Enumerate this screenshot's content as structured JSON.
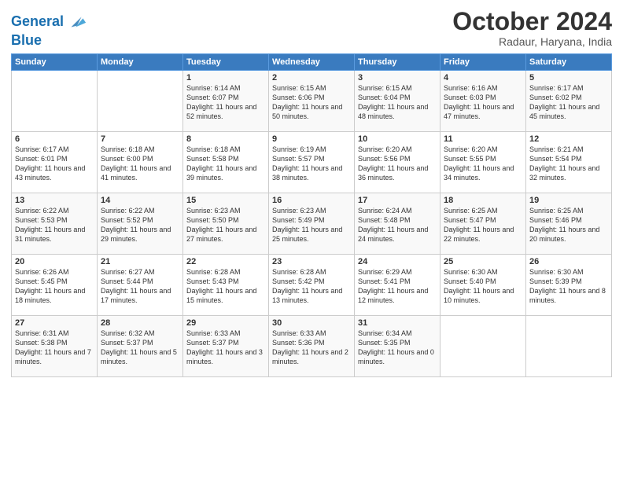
{
  "logo": {
    "line1": "General",
    "line2": "Blue"
  },
  "header": {
    "month": "October 2024",
    "location": "Radaur, Haryana, India"
  },
  "weekdays": [
    "Sunday",
    "Monday",
    "Tuesday",
    "Wednesday",
    "Thursday",
    "Friday",
    "Saturday"
  ],
  "weeks": [
    [
      {
        "day": "",
        "content": ""
      },
      {
        "day": "",
        "content": ""
      },
      {
        "day": "1",
        "content": "Sunrise: 6:14 AM\nSunset: 6:07 PM\nDaylight: 11 hours and 52 minutes."
      },
      {
        "day": "2",
        "content": "Sunrise: 6:15 AM\nSunset: 6:06 PM\nDaylight: 11 hours and 50 minutes."
      },
      {
        "day": "3",
        "content": "Sunrise: 6:15 AM\nSunset: 6:04 PM\nDaylight: 11 hours and 48 minutes."
      },
      {
        "day": "4",
        "content": "Sunrise: 6:16 AM\nSunset: 6:03 PM\nDaylight: 11 hours and 47 minutes."
      },
      {
        "day": "5",
        "content": "Sunrise: 6:17 AM\nSunset: 6:02 PM\nDaylight: 11 hours and 45 minutes."
      }
    ],
    [
      {
        "day": "6",
        "content": "Sunrise: 6:17 AM\nSunset: 6:01 PM\nDaylight: 11 hours and 43 minutes."
      },
      {
        "day": "7",
        "content": "Sunrise: 6:18 AM\nSunset: 6:00 PM\nDaylight: 11 hours and 41 minutes."
      },
      {
        "day": "8",
        "content": "Sunrise: 6:18 AM\nSunset: 5:58 PM\nDaylight: 11 hours and 39 minutes."
      },
      {
        "day": "9",
        "content": "Sunrise: 6:19 AM\nSunset: 5:57 PM\nDaylight: 11 hours and 38 minutes."
      },
      {
        "day": "10",
        "content": "Sunrise: 6:20 AM\nSunset: 5:56 PM\nDaylight: 11 hours and 36 minutes."
      },
      {
        "day": "11",
        "content": "Sunrise: 6:20 AM\nSunset: 5:55 PM\nDaylight: 11 hours and 34 minutes."
      },
      {
        "day": "12",
        "content": "Sunrise: 6:21 AM\nSunset: 5:54 PM\nDaylight: 11 hours and 32 minutes."
      }
    ],
    [
      {
        "day": "13",
        "content": "Sunrise: 6:22 AM\nSunset: 5:53 PM\nDaylight: 11 hours and 31 minutes."
      },
      {
        "day": "14",
        "content": "Sunrise: 6:22 AM\nSunset: 5:52 PM\nDaylight: 11 hours and 29 minutes."
      },
      {
        "day": "15",
        "content": "Sunrise: 6:23 AM\nSunset: 5:50 PM\nDaylight: 11 hours and 27 minutes."
      },
      {
        "day": "16",
        "content": "Sunrise: 6:23 AM\nSunset: 5:49 PM\nDaylight: 11 hours and 25 minutes."
      },
      {
        "day": "17",
        "content": "Sunrise: 6:24 AM\nSunset: 5:48 PM\nDaylight: 11 hours and 24 minutes."
      },
      {
        "day": "18",
        "content": "Sunrise: 6:25 AM\nSunset: 5:47 PM\nDaylight: 11 hours and 22 minutes."
      },
      {
        "day": "19",
        "content": "Sunrise: 6:25 AM\nSunset: 5:46 PM\nDaylight: 11 hours and 20 minutes."
      }
    ],
    [
      {
        "day": "20",
        "content": "Sunrise: 6:26 AM\nSunset: 5:45 PM\nDaylight: 11 hours and 18 minutes."
      },
      {
        "day": "21",
        "content": "Sunrise: 6:27 AM\nSunset: 5:44 PM\nDaylight: 11 hours and 17 minutes."
      },
      {
        "day": "22",
        "content": "Sunrise: 6:28 AM\nSunset: 5:43 PM\nDaylight: 11 hours and 15 minutes."
      },
      {
        "day": "23",
        "content": "Sunrise: 6:28 AM\nSunset: 5:42 PM\nDaylight: 11 hours and 13 minutes."
      },
      {
        "day": "24",
        "content": "Sunrise: 6:29 AM\nSunset: 5:41 PM\nDaylight: 11 hours and 12 minutes."
      },
      {
        "day": "25",
        "content": "Sunrise: 6:30 AM\nSunset: 5:40 PM\nDaylight: 11 hours and 10 minutes."
      },
      {
        "day": "26",
        "content": "Sunrise: 6:30 AM\nSunset: 5:39 PM\nDaylight: 11 hours and 8 minutes."
      }
    ],
    [
      {
        "day": "27",
        "content": "Sunrise: 6:31 AM\nSunset: 5:38 PM\nDaylight: 11 hours and 7 minutes."
      },
      {
        "day": "28",
        "content": "Sunrise: 6:32 AM\nSunset: 5:37 PM\nDaylight: 11 hours and 5 minutes."
      },
      {
        "day": "29",
        "content": "Sunrise: 6:33 AM\nSunset: 5:37 PM\nDaylight: 11 hours and 3 minutes."
      },
      {
        "day": "30",
        "content": "Sunrise: 6:33 AM\nSunset: 5:36 PM\nDaylight: 11 hours and 2 minutes."
      },
      {
        "day": "31",
        "content": "Sunrise: 6:34 AM\nSunset: 5:35 PM\nDaylight: 11 hours and 0 minutes."
      },
      {
        "day": "",
        "content": ""
      },
      {
        "day": "",
        "content": ""
      }
    ]
  ]
}
